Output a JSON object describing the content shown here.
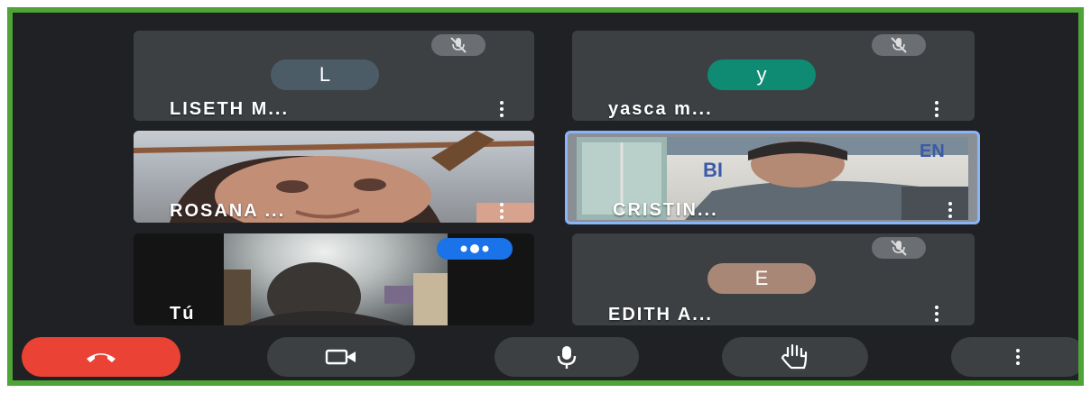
{
  "participants": [
    {
      "initial": "L",
      "name": "LISETH M...",
      "avatar_color": "#4c5c66"
    },
    {
      "initial": "y",
      "name": "yasca m...",
      "avatar_color": "#0f8a73"
    },
    {
      "name": "ROSANA ..."
    },
    {
      "name": "CRISTIN..."
    },
    {
      "name": "Tú"
    },
    {
      "initial": "E",
      "name": "EDITH A...",
      "avatar_color": "#a98777"
    }
  ],
  "icons": {
    "muted": "mic-off-icon",
    "more": "more-vert-icon",
    "speaking": "speaking-dots-icon",
    "hangup": "call-end-icon",
    "camera": "videocam-icon",
    "mic": "mic-icon",
    "hand": "raise-hand-icon"
  },
  "colors": {
    "frame": "#4ea436",
    "background": "#202124",
    "tile": "#3c4043",
    "hangup": "#ea4335",
    "active_speaker": "#8ab4f8",
    "speaking_badge": "#1a73e8"
  }
}
